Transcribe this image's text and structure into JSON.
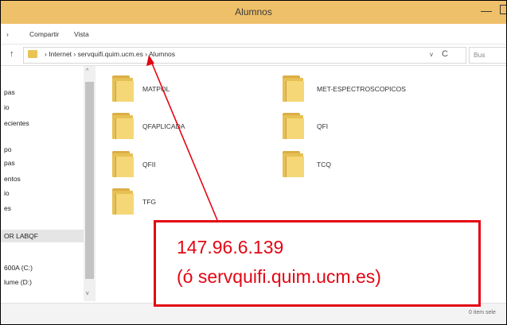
{
  "window": {
    "title": "Alumnos"
  },
  "ribbon": {
    "tabs": [
      "Compartir",
      "Vista"
    ],
    "left_fragment": "›"
  },
  "address": {
    "up": "↑",
    "path": [
      "Internet",
      "servquifi.quim.ucm.es",
      "Alumnos"
    ],
    "separator": "›",
    "dropdown": "v",
    "refresh": "C",
    "search_placeholder": "Bus"
  },
  "nav_pane": {
    "items": [
      "pas",
      "io",
      "ecientes",
      "po",
      "pas",
      "entos",
      "io",
      "es",
      "OR LABQF",
      "600A (C:)",
      "lume (D:)"
    ],
    "selected_index": 8
  },
  "folders": [
    {
      "name": "MATPOL"
    },
    {
      "name": "MET-ESPECTROSCOPICOS"
    },
    {
      "name": "QFAPLICADA"
    },
    {
      "name": "QFI"
    },
    {
      "name": "QFII"
    },
    {
      "name": "TCQ"
    },
    {
      "name": "TFG"
    }
  ],
  "status_bar": {
    "right_text": "0 item sele"
  },
  "annotation": {
    "line1": "147.96.6.139",
    "line2": "(ó servquifi.quim.ucm.es)",
    "color": "#e30613"
  },
  "colors": {
    "titlebar": "#efc06a",
    "folder": "#e6c053"
  }
}
